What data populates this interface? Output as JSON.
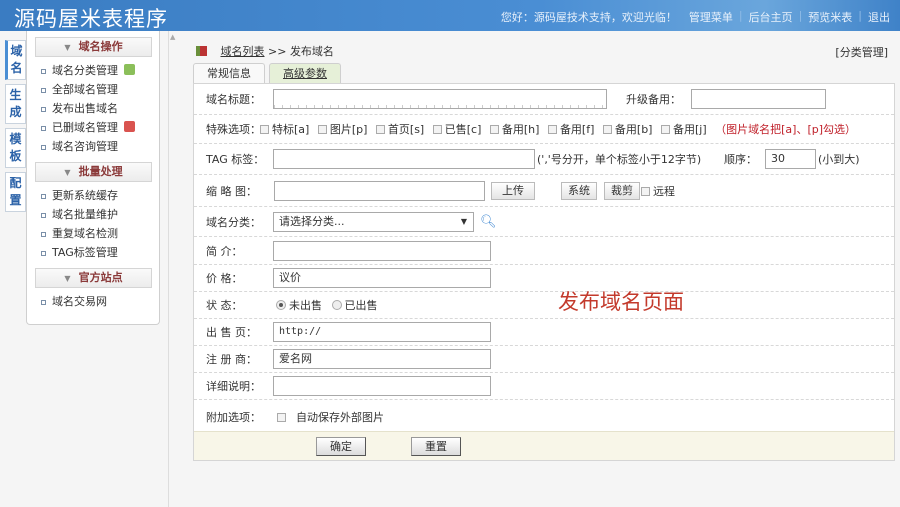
{
  "header": {
    "title": "源码屋米表程序",
    "greeting": "您好：源码屋技术支持，欢迎光临！",
    "nav": [
      "管理菜单",
      "后台主页",
      "预览米表",
      "退出"
    ]
  },
  "vtabs": [
    "域名",
    "生成",
    "模板",
    "配置"
  ],
  "sidebar": [
    {
      "title": "域名操作",
      "items": [
        "域名分类管理",
        "全部域名管理",
        "发布出售域名",
        "已删域名管理",
        "域名咨询管理"
      ]
    },
    {
      "title": "批量处理",
      "items": [
        "更新系统缓存",
        "域名批量维护",
        "重复域名检测",
        "TAG标签管理"
      ]
    },
    {
      "title": "官方站点",
      "items": [
        "域名交易网"
      ]
    }
  ],
  "breadcrumb": {
    "link": "域名列表",
    "sep": ">>",
    "current": "发布域名"
  },
  "category_manage": "[分类管理]",
  "tabs": [
    "常规信息",
    "高级参数"
  ],
  "form": {
    "title_label": "域名标题：",
    "upgrade_label": "升级备用：",
    "special_label": "特殊选项：",
    "special_options": [
      "特标[a]",
      "图片[p]",
      "首页[s]",
      "已售[c]",
      "备用[h]",
      "备用[f]",
      "备用[b]",
      "备用[j]"
    ],
    "special_note": "（图片域名把[a]、[p]勾选）",
    "tag_label": "TAG 标签：",
    "tag_note": "(','号分开，单个标签小于12字节)",
    "order_label": "顺序：",
    "order_value": "30",
    "order_note": "(小到大)",
    "thumb_label": "缩 略 图：",
    "upload": "上传",
    "system": "系统",
    "crop": "裁剪",
    "remote": "远程",
    "category_label": "域名分类：",
    "category_value": "请选择分类...",
    "intro_label": "简 介：",
    "price_label": "价 格：",
    "price_value": "议价",
    "status_label": "状 态：",
    "status_options": [
      "未出售",
      "已出售"
    ],
    "sale_label": "出 售 页：",
    "sale_value": "http://",
    "registrar_label": "注 册 商：",
    "registrar_value": "爱名网",
    "detail_label": "详细说明：",
    "extra_label": "附加选项：",
    "extra_option": "自动保存外部图片",
    "submit": "确定",
    "reset": "重置"
  },
  "overlay_text": "发布域名页面"
}
